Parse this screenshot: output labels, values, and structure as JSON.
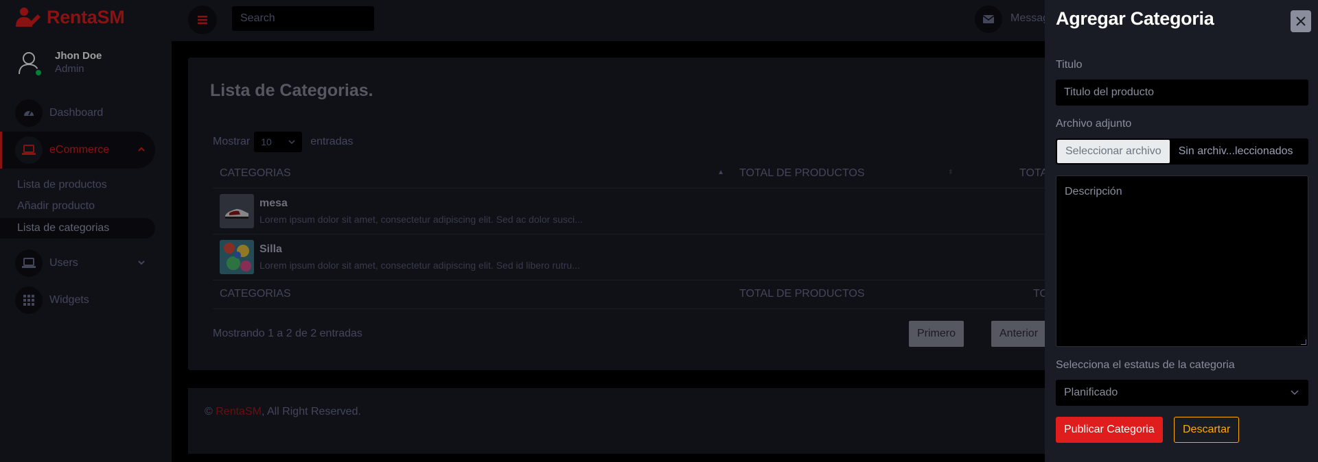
{
  "brand": {
    "name": "RentaSM"
  },
  "profile": {
    "name": "Jhon Doe",
    "role": "Admin"
  },
  "sidebar": {
    "items": [
      {
        "label": "Dashboard",
        "icon": "speedometer-icon"
      },
      {
        "label": "eCommerce",
        "icon": "laptop-icon",
        "active": true
      },
      {
        "label": "Users",
        "icon": "laptop-icon"
      },
      {
        "label": "Widgets",
        "icon": "grid-icon"
      }
    ],
    "ecommerce_sub": [
      {
        "label": "Lista de productos"
      },
      {
        "label": "Añadir producto"
      },
      {
        "label": "Lista de categorias",
        "active": true
      }
    ]
  },
  "topbar": {
    "search_placeholder": "Search",
    "messages_label": "Messag"
  },
  "main": {
    "title": "Lista de Categorias.",
    "length": {
      "prefix": "Mostrar",
      "value": "10",
      "suffix": "entradas"
    },
    "columns": [
      "CATEGORIAS",
      "TOTAL DE PRODUCTOS",
      "TOTAL GANAD"
    ],
    "footer_columns": [
      "CATEGORIAS",
      "TOTAL DE PRODUCTOS",
      "TOTAL GANA"
    ],
    "rows": [
      {
        "name": "mesa",
        "desc": "Lorem ipsum dolor sit amet, consectetur adipiscing elit. Sed ac dolor susci...",
        "earn": "$"
      },
      {
        "name": "Silla",
        "desc": "Lorem ipsum dolor sit amet, consectetur adipiscing elit. Sed id libero rutru...",
        "earn": "$"
      }
    ],
    "showing": "Mostrando 1 a 2 de 2 entradas",
    "pagination": {
      "first": "Primero",
      "prev": "Anterior"
    }
  },
  "footer": {
    "prefix": "©",
    "brand": "RentaSM",
    "suffix": ", All Right Reserved."
  },
  "offcanvas": {
    "title": "Agregar Categoria",
    "title_label": "Titulo",
    "title_placeholder": "Titulo del producto",
    "file_label": "Archivo adjunto",
    "file_button": "Seleccionar archivo",
    "file_status": "Sin archiv...leccionados",
    "desc_placeholder": "Descripción",
    "status_label": "Selecciona el estatus de la categoria",
    "status_value": "Planificado",
    "publish": "Publicar Categoria",
    "discard": "Descartar"
  },
  "colors": {
    "accent": "#e01d1d",
    "warning": "#ffab00",
    "sidebar_bg": "#191c24",
    "page_bg": "#000000"
  }
}
